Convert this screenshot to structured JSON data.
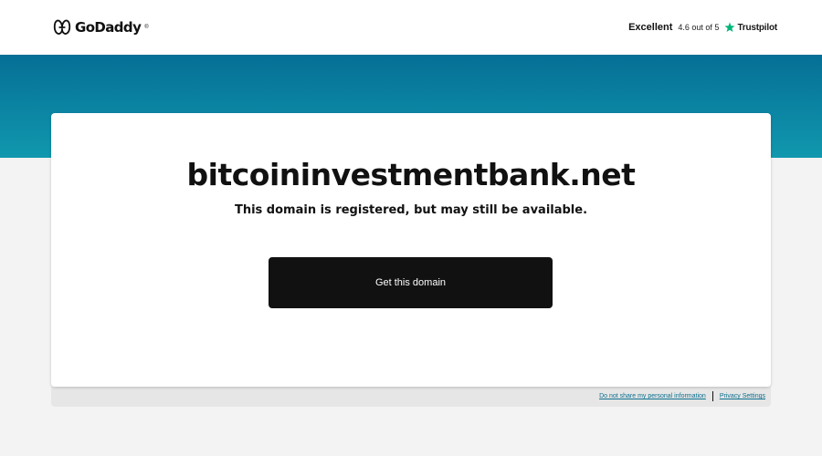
{
  "header": {
    "logo_text": "GoDaddy",
    "logo_tm": "®",
    "rating_label": "Excellent",
    "rating_score": "4.6 out of 5",
    "trustpilot_label": "Trustpilot"
  },
  "main": {
    "domain": "bitcoininvestmentbank.net",
    "subtitle": "This domain is registered, but may still be available.",
    "cta_label": "Get this domain"
  },
  "footer": {
    "do_not_share": "Do not share my personal information",
    "privacy_settings": "Privacy Settings"
  },
  "colors": {
    "hero_top": "#066f95",
    "hero_bottom": "#1198ae",
    "trustpilot_green": "#00b67a",
    "cta_background": "#111111",
    "link": "#0c6f8e"
  },
  "icons": [
    "godaddy-logo-icon",
    "trustpilot-star-icon"
  ]
}
